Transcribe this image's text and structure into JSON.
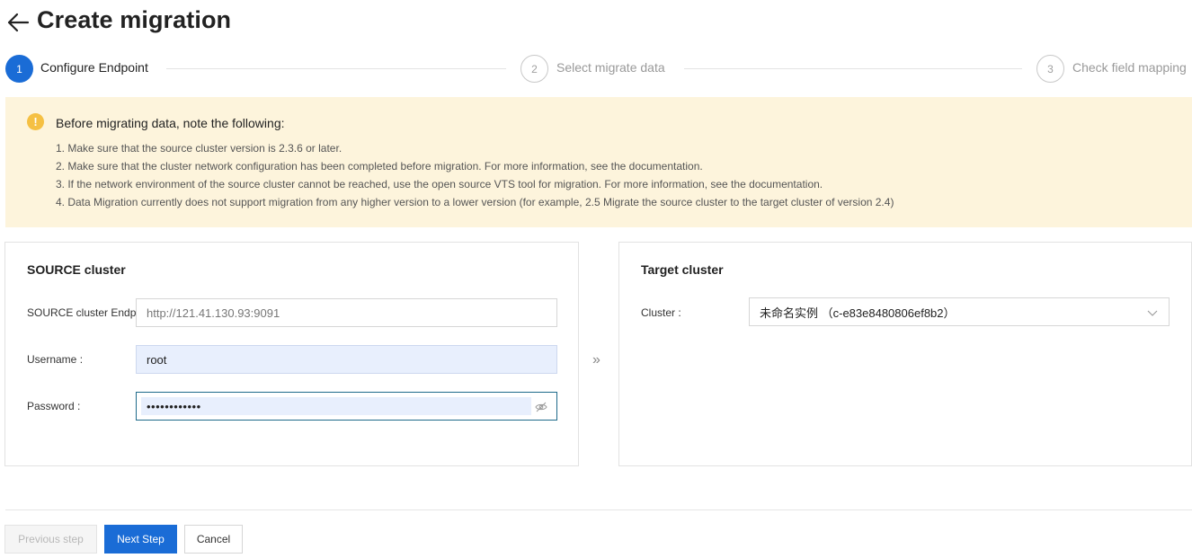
{
  "header": {
    "title": "Create migration"
  },
  "steps": [
    {
      "number": "1",
      "label": "Configure Endpoint"
    },
    {
      "number": "2",
      "label": "Select migrate data"
    },
    {
      "number": "3",
      "label": "Check field mapping"
    }
  ],
  "notice": {
    "icon": "!",
    "title": "Before migrating data, note the following:",
    "items": [
      "1. Make sure that the source cluster version is 2.3.6 or later.",
      "2. Make sure that the cluster network configuration has been completed before migration. For more information, see the documentation.",
      "3. If the network environment of the source cluster cannot be reached, use the open source VTS tool for migration. For more information, see the documentation.",
      "4. Data Migration currently does not support migration from any higher version to a lower version (for example, 2.5 Migrate the source cluster to the target cluster of version 2.4)"
    ]
  },
  "source": {
    "title": "SOURCE cluster",
    "endpoint_label": "SOURCE cluster Endpoint :",
    "endpoint_value": "http://121.41.130.93:9091",
    "username_label": "Username :",
    "username_value": "root",
    "password_label": "Password :",
    "password_value": "••••••••••••"
  },
  "separator": "»",
  "target": {
    "title": "Target cluster",
    "cluster_label": "Cluster :",
    "cluster_value": "未命名实例 （c-e83e8480806ef8b2）"
  },
  "footer": {
    "previous_label": "Previous step",
    "next_label": "Next Step",
    "cancel_label": "Cancel"
  },
  "colors": {
    "accent": "#1a6cd6",
    "notice_bg": "#fdf4dc",
    "warning": "#f5c043"
  }
}
